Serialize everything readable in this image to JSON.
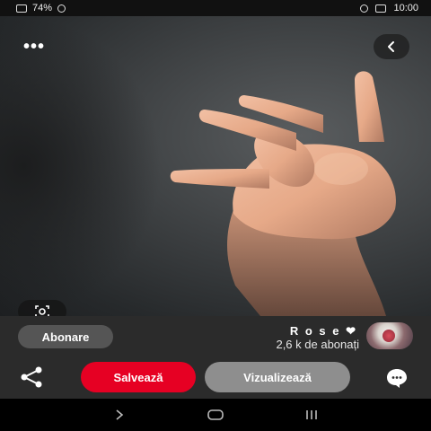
{
  "status_bar": {
    "battery": "74%",
    "time": "10:00"
  },
  "pin": {
    "image_description": "hand-reaching-photo",
    "more_icon": "more-dots-icon",
    "back_icon": "chevron-back-icon",
    "lens_icon": "visual-search-icon"
  },
  "creator": {
    "name": "R o s e ❤",
    "followers": "2,6 k de abonați",
    "follow_label": "Abonare"
  },
  "actions": {
    "share_icon": "share-icon",
    "save_label": "Salvează",
    "visit_label": "Vizualizează",
    "comment_icon": "comment-icon"
  },
  "colors": {
    "save": "#e60023",
    "visit": "#8e8e8e",
    "panel": "#2b2b2b"
  }
}
